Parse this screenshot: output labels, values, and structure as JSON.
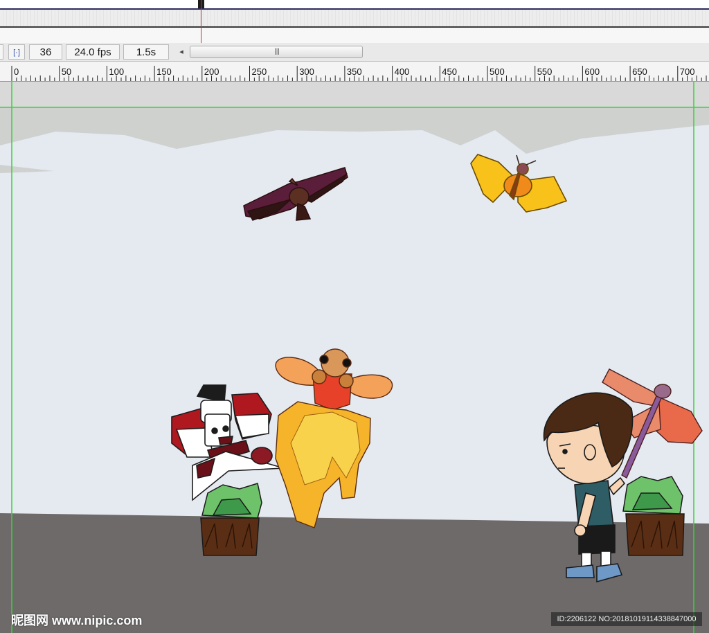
{
  "status_bar": {
    "center_frame_icon": "center-frame-icon",
    "current_frame": "36",
    "frame_rate": "24.0 fps",
    "elapsed_time": "1.5s",
    "scroll_left_icon": "chevron-left-icon",
    "scroll_grip_icon": "grip-icon"
  },
  "ruler": {
    "labels": [
      "0",
      "50",
      "100",
      "150",
      "200",
      "250",
      "300",
      "350",
      "400",
      "450",
      "500",
      "550",
      "600",
      "650",
      "700"
    ]
  },
  "stage": {
    "guide_color": "#35d535",
    "sky_color": "#e5e9f0",
    "ground_color": "#6e6a6a",
    "objects": [
      "eagle-kite",
      "butterfly-kite",
      "clown-kite",
      "goldfish-kite",
      "dragonfly-kite",
      "boy",
      "potted-plant-left",
      "potted-plant-right"
    ]
  },
  "watermark": {
    "left_text": "昵图网 www.nipic.com",
    "right_text": "ID:2206122 NO:20181019114338847000"
  }
}
